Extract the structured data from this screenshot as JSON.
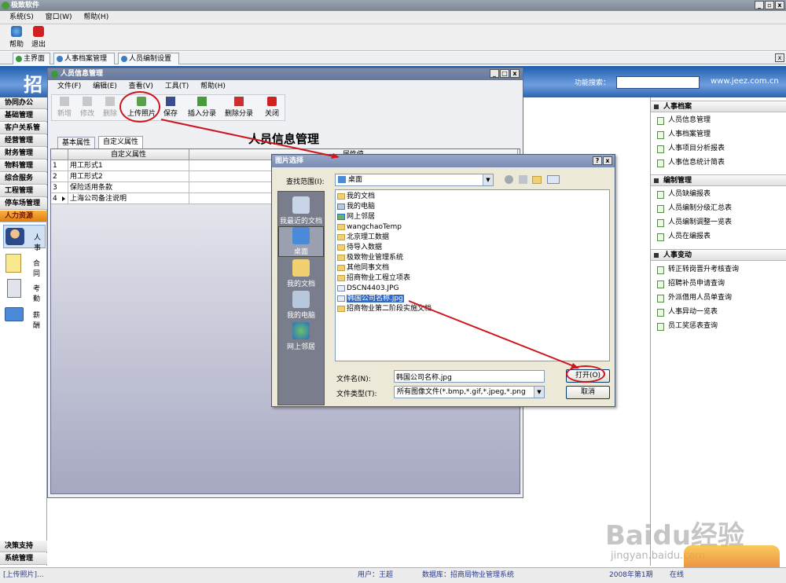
{
  "app": {
    "title": "极致软件"
  },
  "menubar": [
    "系统(S)",
    "窗口(W)",
    "帮助(H)"
  ],
  "toolbar": {
    "help": "帮助",
    "exit": "退出"
  },
  "tabs": [
    "主界面",
    "人事档案管理",
    "人员编制设置"
  ],
  "banner": {
    "logo_char": "招",
    "search_label": "功能搜索：",
    "url": "www.jeez.com.cn"
  },
  "left_nav": {
    "groups": [
      "协同办公",
      "基础管理",
      "客户关系管",
      "经营管理",
      "财务管理",
      "物料管理",
      "综合服务",
      "工程管理",
      "停车场管理"
    ],
    "active": "人力资源",
    "modules": [
      "人事",
      "合同",
      "考勤",
      "薪酬"
    ],
    "bottom": [
      "决策支持",
      "系统管理"
    ]
  },
  "inner": {
    "title": "人员信息管理",
    "menu": [
      "文件(F)",
      "编辑(E)",
      "查看(V)",
      "工具(T)",
      "帮助(H)"
    ],
    "tools": [
      "新增",
      "修改",
      "删除",
      "上传照片",
      "保存",
      "插入分录",
      "删除分录",
      "关闭"
    ],
    "heading": "人员信息管理",
    "tabs": [
      "基本属性",
      "自定义属性"
    ],
    "grid_header": [
      "自定义属性",
      "属性值"
    ],
    "rows": [
      {
        "n": "1",
        "name": "用工形式1"
      },
      {
        "n": "2",
        "name": "用工形式2"
      },
      {
        "n": "3",
        "name": "保险适用条款"
      },
      {
        "n": "4",
        "name": "上海公司备注说明"
      }
    ]
  },
  "dialog": {
    "title": "图片选择",
    "lookin_label": "查找范围(I):",
    "lookin_value": "桌面",
    "places": [
      "我最近的文档",
      "桌面",
      "我的文档",
      "我的电脑",
      "网上邻居"
    ],
    "files": [
      "我的文档",
      "我的电脑",
      "网上邻居",
      "wangchaoTemp",
      "北京理工数据",
      "待导入数据",
      "极致物业管理系统",
      "其他同事文档",
      "招商物业工程立项表",
      "DSCN4403.JPG",
      "韩国公司名称.jpg",
      "招商物业第二阶段实施文档"
    ],
    "filename_label": "文件名(N):",
    "filename_value": "韩国公司名称.jpg",
    "filetype_label": "文件类型(T):",
    "filetype_value": "所有图像文件(*.bmp,*.gif,*.jpeg,*.png",
    "open": "打开(O)",
    "cancel": "取消"
  },
  "right_panel": {
    "sections": [
      {
        "title": "人事档案",
        "items": [
          "人员信息管理",
          "人事档案管理",
          "人事项目分析报表",
          "人事信息统计简表"
        ]
      },
      {
        "title": "编制管理",
        "items": [
          "人员缺编报表",
          "人员编制分级汇总表",
          "人员编制调整一览表",
          "人员在编报表"
        ]
      },
      {
        "title": "人事变动",
        "items": [
          "转正转岗晋升考核查询",
          "招聘补员申请查询",
          "外派借用人员单查询",
          "人事异动一览表",
          "员工奖惩表查询"
        ]
      }
    ]
  },
  "status": {
    "left": "[上传照片]...",
    "user": "用户：王超",
    "db": "数据库：招商局物业管理系统",
    "period": "2008年第1期",
    "online": "在线"
  },
  "watermark": {
    "brand": "Baidu经验",
    "url": "jingyan.baidu.com"
  }
}
